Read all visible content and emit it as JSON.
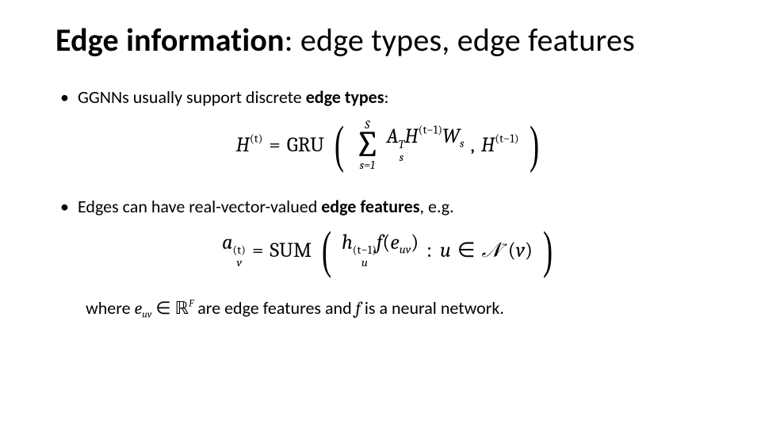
{
  "title": {
    "bold": "Edge information",
    "rest": ": edge types, edge features"
  },
  "bullets": {
    "b1_pre": "GGNNs usually support discrete ",
    "b1_bold": "edge types",
    "b1_post": ":",
    "b2_pre": "Edges can have real-vector-valued ",
    "b2_bold": "edge features",
    "b2_post": ", e.g."
  },
  "eq1": {
    "lhs_base": "H",
    "lhs_sup": "(t)",
    "op": "GRU",
    "sum_upper": "S",
    "sum_lower": "s=1",
    "term_A_base": "A",
    "term_A_sup": "T",
    "term_A_sub": "s",
    "term_H_base": "H",
    "term_H_sup": "(t−1)",
    "term_W_base": "W",
    "term_W_sub": "s",
    "arg2_base": "H",
    "arg2_sup": "(t−1)"
  },
  "eq2": {
    "lhs_base": "a",
    "lhs_sup": "(t)",
    "lhs_sub": "v",
    "op": "SUM",
    "h_base": "h",
    "h_sup": "(t−1)",
    "h_sub": "u",
    "f": "f",
    "e_base": "e",
    "e_sub": "uv",
    "colon": " : ",
    "u": "u",
    "in": "∈",
    "N": "ℕ",
    "N_disp": "𝒩",
    "N_sup": "−",
    "v": "v"
  },
  "where": {
    "pre": "where ",
    "e_base": "e",
    "e_sub": "uv",
    "in": " ∈ ",
    "R": "ℝ",
    "R_sup": "F",
    "mid": " are edge features and ",
    "f": "f",
    "post": " is a neural network."
  }
}
